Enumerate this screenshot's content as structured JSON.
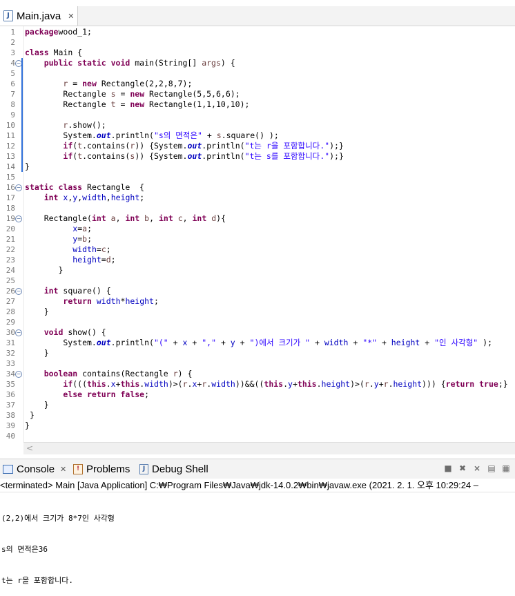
{
  "editor": {
    "tab": {
      "title": "Main.java",
      "close": "✕",
      "icon": "java-file-icon"
    },
    "lines": [
      {
        "n": "1",
        "t": [
          [
            "kw",
            "package"
          ],
          [
            "",
            "wood_1;"
          ]
        ]
      },
      {
        "n": "2",
        "t": []
      },
      {
        "n": "3",
        "t": [
          [
            "kw",
            "class"
          ],
          [
            "",
            " Main {"
          ]
        ]
      },
      {
        "n": "4",
        "t": [
          [
            "",
            "    "
          ],
          [
            "kw",
            "public static void"
          ],
          [
            "",
            " main(String[] "
          ],
          [
            "prm",
            "args"
          ],
          [
            "",
            ") {"
          ]
        ]
      },
      {
        "n": "5",
        "t": []
      },
      {
        "n": "6",
        "t": [
          [
            "",
            "        "
          ],
          [
            "prm",
            "r"
          ],
          [
            "",
            " = "
          ],
          [
            "kw",
            "new"
          ],
          [
            "",
            " Rectangle(2,2,8,7);"
          ]
        ]
      },
      {
        "n": "7",
        "t": [
          [
            "",
            "        Rectangle "
          ],
          [
            "prm",
            "s"
          ],
          [
            "",
            " = "
          ],
          [
            "kw",
            "new"
          ],
          [
            "",
            " Rectangle(5,5,6,6);"
          ]
        ]
      },
      {
        "n": "8",
        "t": [
          [
            "",
            "        Rectangle "
          ],
          [
            "prm",
            "t"
          ],
          [
            "",
            " = "
          ],
          [
            "kw",
            "new"
          ],
          [
            "",
            " Rectangle(1,1,10,10);"
          ]
        ]
      },
      {
        "n": "9",
        "t": []
      },
      {
        "n": "10",
        "t": [
          [
            "",
            "        "
          ],
          [
            "prm",
            "r"
          ],
          [
            "",
            ".show();"
          ]
        ]
      },
      {
        "n": "11",
        "t": [
          [
            "",
            "        System."
          ],
          [
            "sfld",
            "out"
          ],
          [
            "",
            ".println("
          ],
          [
            "str",
            "\"s의 면적은\""
          ],
          [
            "",
            " + "
          ],
          [
            "prm",
            "s"
          ],
          [
            "",
            ".square() );"
          ]
        ]
      },
      {
        "n": "12",
        "t": [
          [
            "",
            "        "
          ],
          [
            "kw",
            "if"
          ],
          [
            "",
            "("
          ],
          [
            "prm",
            "t"
          ],
          [
            "",
            ".contains("
          ],
          [
            "prm",
            "r"
          ],
          [
            "",
            ")) {System."
          ],
          [
            "sfld",
            "out"
          ],
          [
            "",
            ".println("
          ],
          [
            "str",
            "\"t는 r을 포함합니다.\""
          ],
          [
            "",
            ");}"
          ]
        ]
      },
      {
        "n": "13",
        "t": [
          [
            "",
            "        "
          ],
          [
            "kw",
            "if"
          ],
          [
            "",
            "("
          ],
          [
            "prm",
            "t"
          ],
          [
            "",
            ".contains("
          ],
          [
            "prm",
            "s"
          ],
          [
            "",
            ")) {System."
          ],
          [
            "sfld",
            "out"
          ],
          [
            "",
            ".println("
          ],
          [
            "str",
            "\"t는 s를 포함합니다.\""
          ],
          [
            "",
            ");}"
          ]
        ]
      },
      {
        "n": "14",
        "t": [
          [
            "",
            "}"
          ]
        ]
      },
      {
        "n": "15",
        "t": []
      },
      {
        "n": "16",
        "t": [
          [
            "kw",
            "static class"
          ],
          [
            "",
            " Rectangle  {"
          ]
        ]
      },
      {
        "n": "17",
        "t": [
          [
            "",
            "    "
          ],
          [
            "kw",
            "int"
          ],
          [
            "",
            " "
          ],
          [
            "fld",
            "x"
          ],
          [
            "",
            ","
          ],
          [
            "fld",
            "y"
          ],
          [
            "",
            ","
          ],
          [
            "fld",
            "width"
          ],
          [
            "",
            ","
          ],
          [
            "fld",
            "height"
          ],
          [
            "",
            ";"
          ]
        ]
      },
      {
        "n": "18",
        "t": []
      },
      {
        "n": "19",
        "t": [
          [
            "",
            "    Rectangle("
          ],
          [
            "kw",
            "int"
          ],
          [
            "",
            " "
          ],
          [
            "prm",
            "a"
          ],
          [
            "",
            ", "
          ],
          [
            "kw",
            "int"
          ],
          [
            "",
            " "
          ],
          [
            "prm",
            "b"
          ],
          [
            "",
            ", "
          ],
          [
            "kw",
            "int"
          ],
          [
            "",
            " "
          ],
          [
            "prm",
            "c"
          ],
          [
            "",
            ", "
          ],
          [
            "kw",
            "int"
          ],
          [
            "",
            " "
          ],
          [
            "prm",
            "d"
          ],
          [
            "",
            "){"
          ]
        ]
      },
      {
        "n": "20",
        "t": [
          [
            "",
            "          "
          ],
          [
            "fld",
            "x"
          ],
          [
            "",
            "="
          ],
          [
            "prm",
            "a"
          ],
          [
            "",
            ";"
          ]
        ]
      },
      {
        "n": "21",
        "t": [
          [
            "",
            "          "
          ],
          [
            "fld",
            "y"
          ],
          [
            "",
            "="
          ],
          [
            "prm",
            "b"
          ],
          [
            "",
            ";"
          ]
        ]
      },
      {
        "n": "22",
        "t": [
          [
            "",
            "          "
          ],
          [
            "fld",
            "width"
          ],
          [
            "",
            "="
          ],
          [
            "prm",
            "c"
          ],
          [
            "",
            ";"
          ]
        ]
      },
      {
        "n": "23",
        "t": [
          [
            "",
            "          "
          ],
          [
            "fld",
            "height"
          ],
          [
            "",
            "="
          ],
          [
            "prm",
            "d"
          ],
          [
            "",
            ";"
          ]
        ]
      },
      {
        "n": "24",
        "t": [
          [
            "",
            "       }"
          ]
        ]
      },
      {
        "n": "25",
        "t": []
      },
      {
        "n": "26",
        "t": [
          [
            "",
            "    "
          ],
          [
            "kw",
            "int"
          ],
          [
            "",
            " square() {"
          ]
        ]
      },
      {
        "n": "27",
        "t": [
          [
            "",
            "        "
          ],
          [
            "kw",
            "return"
          ],
          [
            "",
            " "
          ],
          [
            "fld",
            "width"
          ],
          [
            "",
            "*"
          ],
          [
            "fld",
            "height"
          ],
          [
            "",
            ";"
          ]
        ]
      },
      {
        "n": "28",
        "t": [
          [
            "",
            "    }"
          ]
        ]
      },
      {
        "n": "29",
        "t": []
      },
      {
        "n": "30",
        "t": [
          [
            "",
            "    "
          ],
          [
            "kw",
            "void"
          ],
          [
            "",
            " show() {"
          ]
        ]
      },
      {
        "n": "31",
        "t": [
          [
            "",
            "        System."
          ],
          [
            "sfld",
            "out"
          ],
          [
            "",
            ".println("
          ],
          [
            "str",
            "\"(\""
          ],
          [
            "",
            " + "
          ],
          [
            "fld",
            "x"
          ],
          [
            "",
            " + "
          ],
          [
            "str",
            "\",\""
          ],
          [
            "",
            " + "
          ],
          [
            "fld",
            "y"
          ],
          [
            "",
            " + "
          ],
          [
            "str",
            "\")에서 크기가 \""
          ],
          [
            "",
            " + "
          ],
          [
            "fld",
            "width"
          ],
          [
            "",
            " + "
          ],
          [
            "str",
            "\"*\""
          ],
          [
            "",
            " + "
          ],
          [
            "fld",
            "height"
          ],
          [
            "",
            " + "
          ],
          [
            "str",
            "\"인 사각형\""
          ],
          [
            "",
            " );"
          ]
        ]
      },
      {
        "n": "32",
        "t": [
          [
            "",
            "    }"
          ]
        ]
      },
      {
        "n": "33",
        "t": []
      },
      {
        "n": "34",
        "t": [
          [
            "",
            "    "
          ],
          [
            "kw",
            "boolean"
          ],
          [
            "",
            " contains(Rectangle "
          ],
          [
            "prm",
            "r"
          ],
          [
            "",
            ") {"
          ]
        ]
      },
      {
        "n": "35",
        "t": [
          [
            "",
            "        "
          ],
          [
            "kw",
            "if"
          ],
          [
            "",
            "((("
          ],
          [
            "kw",
            "this"
          ],
          [
            "",
            "."
          ],
          [
            "fld",
            "x"
          ],
          [
            "",
            "+"
          ],
          [
            "kw",
            "this"
          ],
          [
            "",
            "."
          ],
          [
            "fld",
            "width"
          ],
          [
            "",
            ")>("
          ],
          [
            "prm",
            "r"
          ],
          [
            "",
            "."
          ],
          [
            "fld",
            "x"
          ],
          [
            "",
            "+"
          ],
          [
            "prm",
            "r"
          ],
          [
            "",
            "."
          ],
          [
            "fld",
            "width"
          ],
          [
            "",
            "))&&(("
          ],
          [
            "kw",
            "this"
          ],
          [
            "",
            "."
          ],
          [
            "fld",
            "y"
          ],
          [
            "",
            "+"
          ],
          [
            "kw",
            "this"
          ],
          [
            "",
            "."
          ],
          [
            "fld",
            "height"
          ],
          [
            "",
            ")>("
          ],
          [
            "prm",
            "r"
          ],
          [
            "",
            "."
          ],
          [
            "fld",
            "y"
          ],
          [
            "",
            "+"
          ],
          [
            "prm",
            "r"
          ],
          [
            "",
            "."
          ],
          [
            "fld",
            "height"
          ],
          [
            "",
            "))) {"
          ],
          [
            "kw",
            "return true"
          ],
          [
            "",
            ";}"
          ]
        ]
      },
      {
        "n": "36",
        "t": [
          [
            "",
            "        "
          ],
          [
            "kw",
            "else return false"
          ],
          [
            "",
            ";"
          ]
        ]
      },
      {
        "n": "37",
        "t": [
          [
            "",
            "    }"
          ]
        ]
      },
      {
        "n": "38",
        "t": [
          [
            "",
            ""
          ],
          [
            "",
            "",
            " "
          ],
          [
            "",
            "}"
          ]
        ]
      },
      {
        "n": "39",
        "t": [
          [
            "",
            "}"
          ]
        ]
      },
      {
        "n": "40",
        "t": []
      }
    ],
    "fold_markers": [
      "4",
      "16",
      "19",
      "26",
      "30",
      "34"
    ],
    "scroll_left_arrow": "<"
  },
  "console": {
    "tabs": [
      {
        "label": "Console",
        "icon": "console-icon",
        "close": "✕"
      },
      {
        "label": "Problems",
        "icon": "problems-icon"
      },
      {
        "label": "Debug Shell",
        "icon": "debug-shell-icon"
      }
    ],
    "toolbar_icons": [
      "terminate-icon",
      "remove-launch-icon",
      "remove-all-icon",
      "pin-console-icon",
      "display-console-icon"
    ],
    "terminated_line": "<terminated> Main [Java Application] C:₩Program Files₩Java₩jdk-14.0.2₩bin₩javaw.exe  (2021. 2. 1. 오후 10:29:24 –",
    "output": [
      "(2,2)에서 크기가 8*7인 사각형",
      "s의 면적은36",
      "t는 r을 포함합니다."
    ]
  },
  "colors": {
    "keyword": "#7f0055",
    "string": "#2a00ff",
    "field": "#0000c0",
    "local": "#6a3e3e",
    "accent": "#2e6fd8"
  }
}
